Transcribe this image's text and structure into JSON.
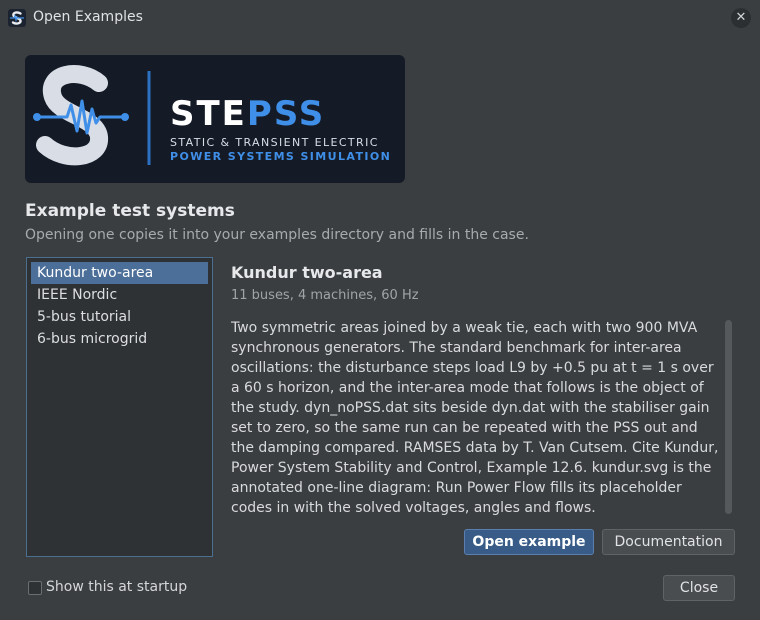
{
  "window": {
    "title": "Open Examples"
  },
  "banner": {
    "name_part1": "STE",
    "name_part2": "PSS",
    "line1": "STATIC & TRANSIENT ELECTRIC",
    "line2": "POWER SYSTEMS SIMULATION"
  },
  "section": {
    "title": "Example test systems",
    "subtitle": "Opening one copies it into your examples directory and fills in the case."
  },
  "examples": [
    {
      "label": "Kundur two-area",
      "selected": true
    },
    {
      "label": "IEEE Nordic",
      "selected": false
    },
    {
      "label": "5-bus tutorial",
      "selected": false
    },
    {
      "label": "6-bus microgrid",
      "selected": false
    }
  ],
  "detail": {
    "title": "Kundur two-area",
    "meta": "11 buses, 4 machines, 60 Hz",
    "description": "Two symmetric areas joined by a weak tie, each with two 900 MVA synchronous generators. The standard benchmark for inter-area oscillations: the disturbance steps load L9 by +0.5 pu at t = 1 s over a 60 s horizon, and the inter-area mode that follows is the object of the study. dyn_noPSS.dat sits beside dyn.dat with the stabiliser gain set to zero, so the same run can be repeated with the PSS out and the damping compared. RAMSES data by T. Van Cutsem. Cite Kundur, Power System Stability and Control, Example 12.6. kundur.svg is the annotated one-line diagram: Run Power Flow fills its placeholder codes in with the solved voltages, angles and flows."
  },
  "buttons": {
    "open_example": "Open example",
    "documentation": "Documentation",
    "close": "Close"
  },
  "startup": {
    "label": "Show this at startup",
    "checked": false
  },
  "colors": {
    "accent": "#4c6f99",
    "brand_blue": "#3f8fe8",
    "banner_bg": "#141b26"
  }
}
